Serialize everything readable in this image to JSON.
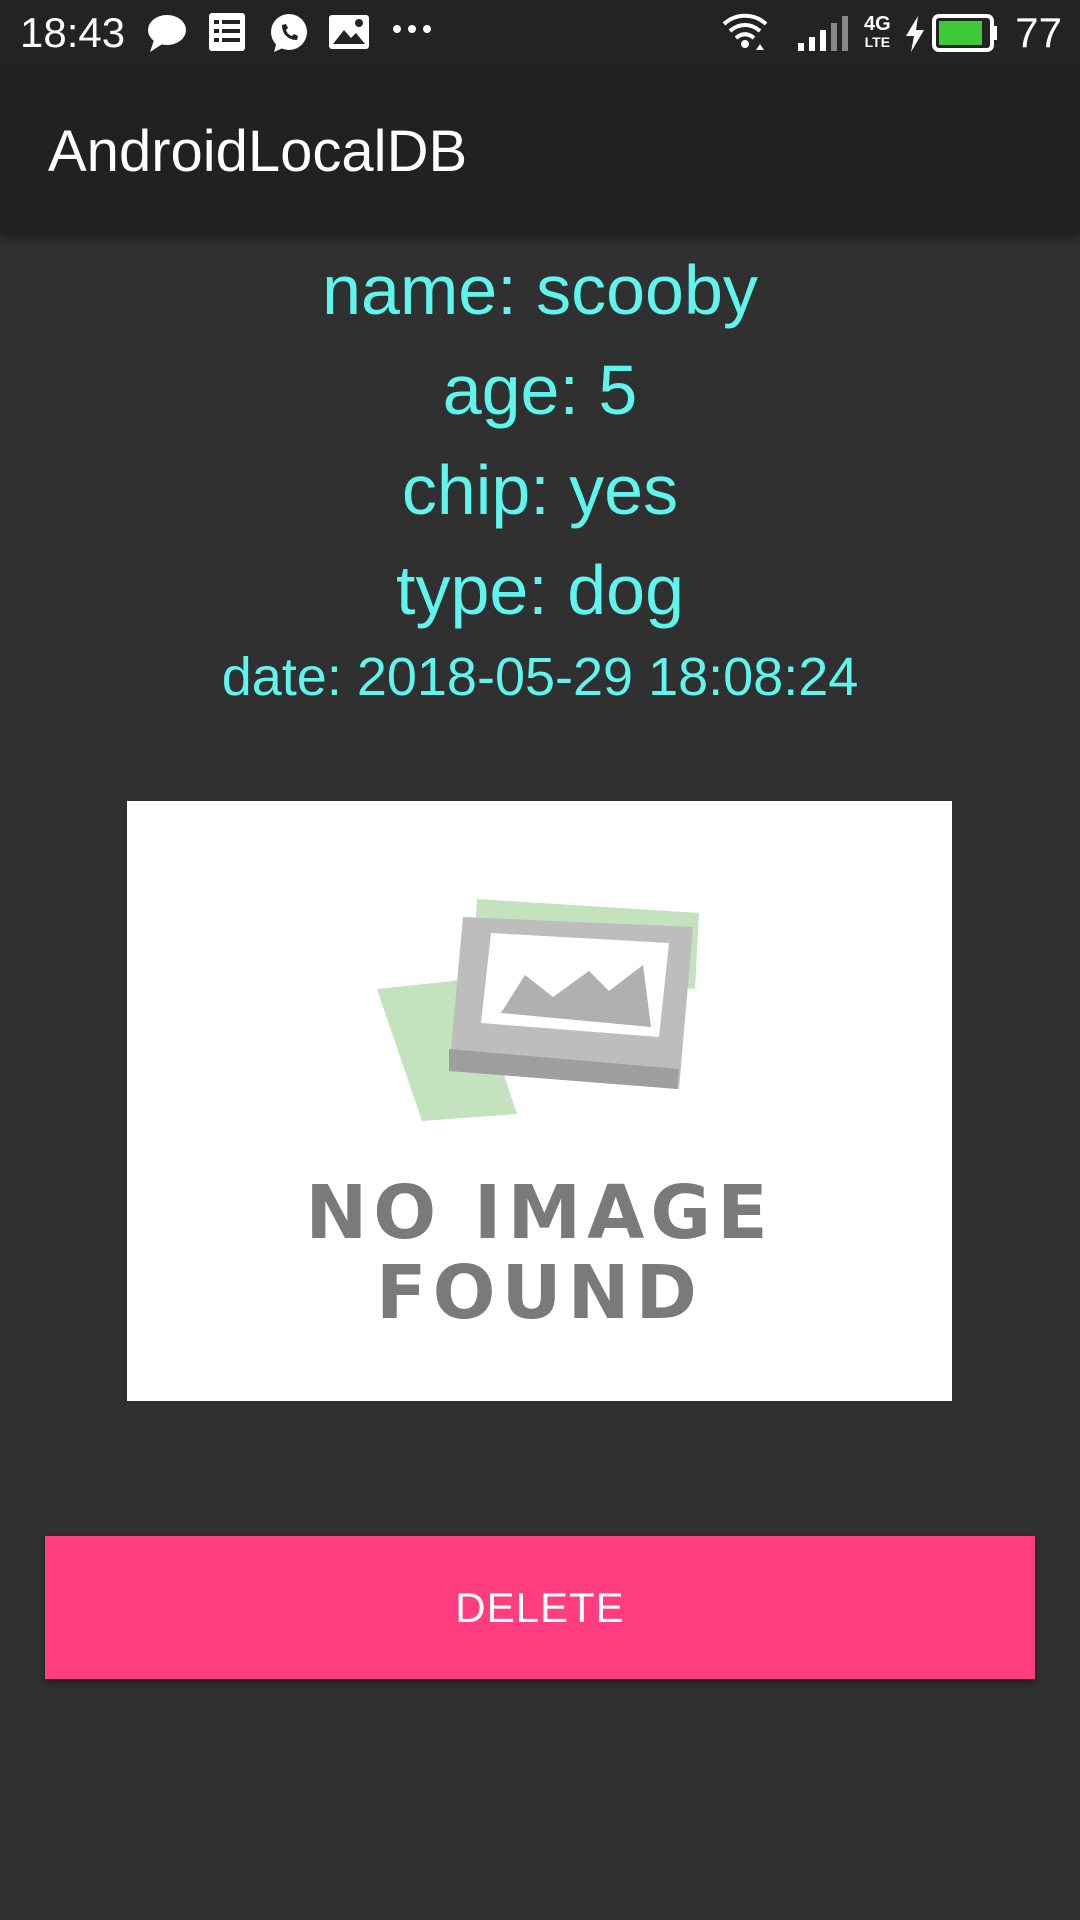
{
  "status_bar": {
    "time": "18:43",
    "network_label": "4G",
    "network_sub_label": "LTE",
    "battery_level": "77",
    "icons": [
      "chat-bubble-icon",
      "list-icon",
      "whatsapp-icon",
      "image-icon",
      "more-dots-icon",
      "wifi-icon",
      "signal-icon",
      "charging-icon",
      "battery-icon"
    ],
    "battery_color": "#3ec93a"
  },
  "app_bar": {
    "title": "AndroidLocalDB"
  },
  "record": {
    "name_line": "name: scooby",
    "age_line": "age: 5",
    "chip_line": "chip: yes",
    "type_line": "type: dog",
    "date_line": "date: 2018-05-29 18:08:24"
  },
  "placeholder_image": {
    "line1": "NO IMAGE",
    "line2": "FOUND"
  },
  "actions": {
    "delete_label": "DELETE"
  },
  "colors": {
    "accent_text": "#5ef5ee",
    "delete_button": "#ff3d7f",
    "background": "#303030",
    "app_bar": "#212121"
  }
}
